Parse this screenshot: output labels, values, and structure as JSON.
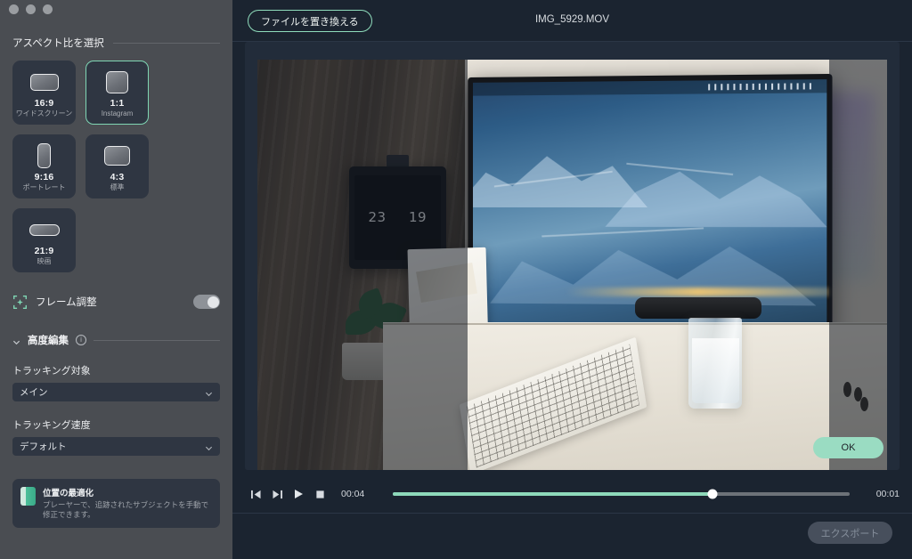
{
  "window": {
    "traffic_lights": [
      "close",
      "minimize",
      "zoom"
    ]
  },
  "sidebar": {
    "section_title": "アスペクト比を選択",
    "ratios": [
      {
        "icon": "rect-16-9-icon",
        "name": "16:9",
        "sub": "ワイドスクリーン",
        "selected": false
      },
      {
        "icon": "square-1-1-icon",
        "name": "1:1",
        "sub": "Instagram",
        "selected": true
      },
      {
        "icon": "rect-9-16-icon",
        "name": "9:16",
        "sub": "ポートレート",
        "selected": false
      },
      {
        "icon": "rect-4-3-icon",
        "name": "4:3",
        "sub": "標準",
        "selected": false
      },
      {
        "icon": "rect-21-9-icon",
        "name": "21:9",
        "sub": "映画",
        "selected": false
      }
    ],
    "frame_adjust": {
      "icon": "frame-adjust-icon",
      "label": "フレーム調整",
      "enabled": true
    },
    "advanced": {
      "title": "高度編集",
      "info_glyph": "i",
      "tracking_target": {
        "label": "トラッキング対象",
        "value": "メイン"
      },
      "tracking_speed": {
        "label": "トラッキング速度",
        "value": "デフォルト"
      },
      "hint": {
        "title": "位置の最適化",
        "body": "プレーヤーで、追跡されたサブジェクトを手動で修正できます。"
      }
    }
  },
  "main": {
    "replace_file_label": "ファイルを置き換える",
    "file_name": "IMG_5929.MOV",
    "ok_label": "OK",
    "export_label": "エクスポート",
    "player": {
      "step_back_icon": "step-backward-icon",
      "step_forward_icon": "step-forward-icon",
      "play_icon": "play-icon",
      "stop_icon": "stop-icon",
      "current_time": "00:04",
      "duration": "00:01",
      "progress_percent": 70
    },
    "preview": {
      "clock_hours": "23",
      "clock_minutes": "19"
    }
  },
  "colors": {
    "accent_mint": "#8ed9ba",
    "sidebar_bg": "#4a4d52",
    "panel_bg": "#1b2430",
    "card_bg": "#2f3642"
  }
}
